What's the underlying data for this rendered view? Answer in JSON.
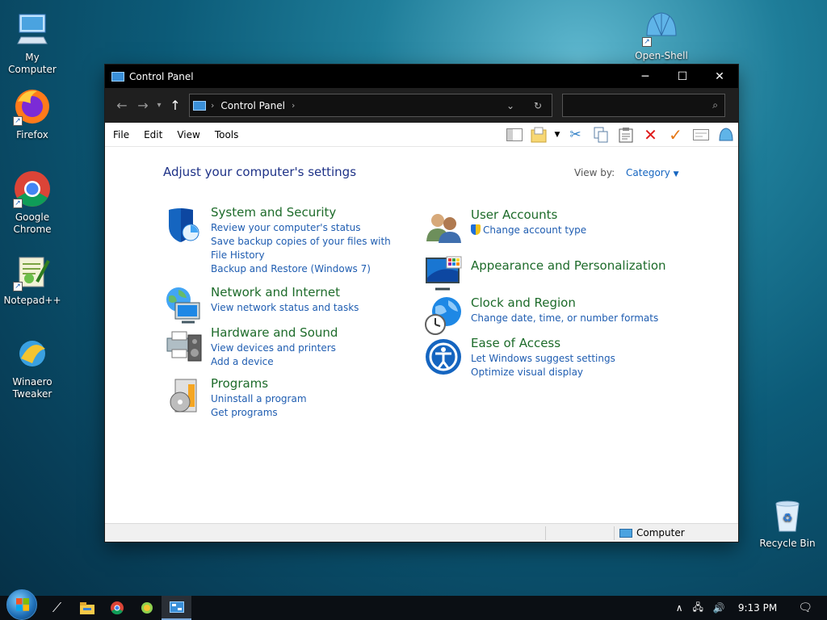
{
  "desktop": {
    "icons": [
      {
        "label": "My Computer"
      },
      {
        "label": "Firefox"
      },
      {
        "label": "Google Chrome"
      },
      {
        "label": "Notepad++"
      },
      {
        "label": "Winaero Tweaker"
      },
      {
        "label": "Open-Shell Menu Sett..."
      },
      {
        "label": "Recycle Bin"
      }
    ]
  },
  "window": {
    "title": "Control Panel",
    "address": {
      "crumb": "Control Panel"
    },
    "search": {
      "placeholder": ""
    },
    "menu": [
      "File",
      "Edit",
      "View",
      "Tools"
    ],
    "heading": "Adjust your computer's settings",
    "view_by": {
      "label": "View by:",
      "value": "Category"
    },
    "categories": [
      {
        "title": "System and Security",
        "links": [
          "Review your computer's status",
          "Save backup copies of your files with File History",
          "Backup and Restore (Windows 7)"
        ]
      },
      {
        "title": "Network and Internet",
        "links": [
          "View network status and tasks"
        ]
      },
      {
        "title": "Hardware and Sound",
        "links": [
          "View devices and printers",
          "Add a device"
        ]
      },
      {
        "title": "Programs",
        "links": [
          "Uninstall a program",
          "Get programs"
        ]
      },
      {
        "title": "User Accounts",
        "links": [
          "Change account type"
        ]
      },
      {
        "title": "Appearance and Personalization",
        "links": []
      },
      {
        "title": "Clock and Region",
        "links": [
          "Change date, time, or number formats"
        ]
      },
      {
        "title": "Ease of Access",
        "links": [
          "Let Windows suggest settings",
          "Optimize visual display"
        ]
      }
    ],
    "status": {
      "location": "Computer"
    }
  },
  "taskbar": {
    "clock": "9:13 PM"
  }
}
